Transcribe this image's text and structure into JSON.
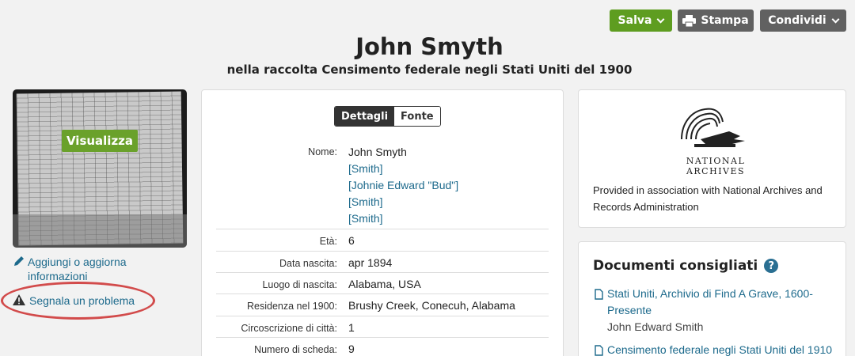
{
  "toolbar": {
    "save_label": "Salva",
    "print_label": "Stampa",
    "share_label": "Condividi"
  },
  "header": {
    "title": "John Smyth",
    "subtitle": "nella raccolta Censimento federale negli Stati Uniti del 1900"
  },
  "left": {
    "view_button": "Visualizza",
    "edit_link": "Aggiungi o aggiorna informazioni",
    "report_link": "Segnala un problema"
  },
  "details": {
    "tabs": [
      "Dettagli",
      "Fonte"
    ],
    "name_label": "Nome:",
    "names": [
      "John Smyth",
      "[Smith]",
      "[Johnie Edward \"Bud\"]",
      "[Smith]",
      "[Smith]"
    ],
    "rows": [
      {
        "label": "Età:",
        "value": "6"
      },
      {
        "label": "Data nascita:",
        "value": "apr 1894"
      },
      {
        "label": "Luogo di nascita:",
        "value": "Alabama, USA"
      },
      {
        "label": "Residenza nel 1900:",
        "value": "Brushy Creek, Conecuh, Alabama"
      },
      {
        "label": "Circoscrizione di città:",
        "value": "1"
      },
      {
        "label": "Numero di scheda:",
        "value": "9"
      }
    ]
  },
  "archive": {
    "logo_line1": "NATIONAL",
    "logo_line2": "ARCHIVES",
    "description": "Provided in association with National Archives and Records Administration"
  },
  "recommended": {
    "title": "Documenti consigliati",
    "help": "?",
    "items": [
      {
        "link": "Stati Uniti, Archivio di Find A Grave, 1600-Presente",
        "sub": "John Edward Smith"
      },
      {
        "link": "Censimento federale negli Stati Uniti del 1910",
        "sub": ""
      }
    ]
  },
  "colors": {
    "accent_green": "#5e9d20",
    "gray_button": "#616161",
    "link_blue": "#1d6a8c",
    "highlight_red": "#d24b4b"
  }
}
